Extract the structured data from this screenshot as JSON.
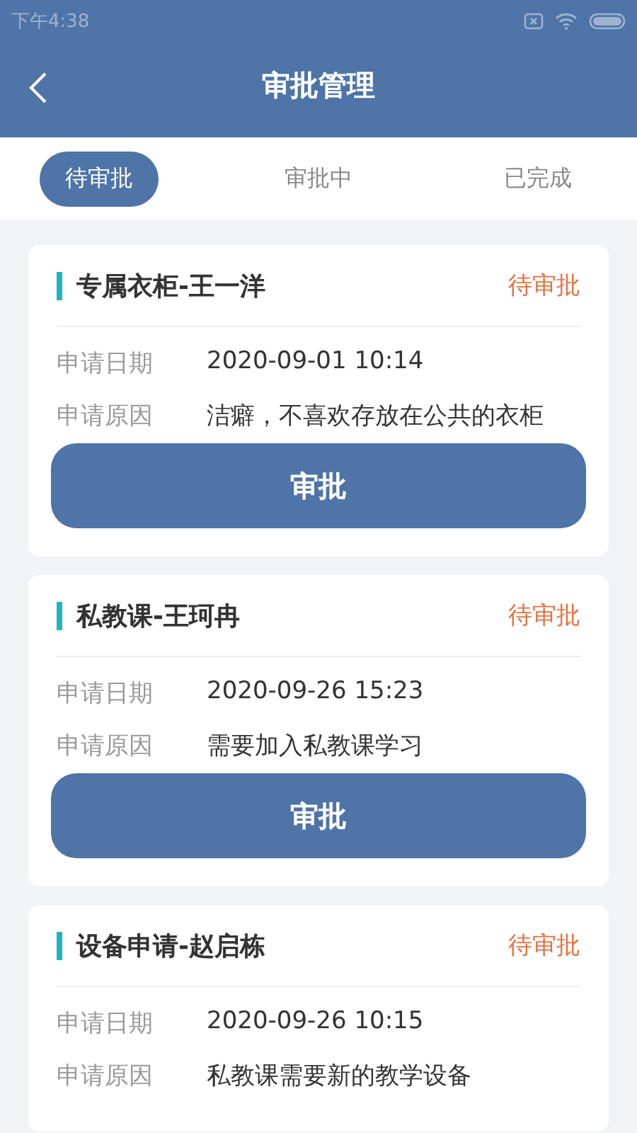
{
  "status_bar": {
    "time": "下午4:38"
  },
  "header": {
    "title": "审批管理"
  },
  "tabs": [
    {
      "label": "待审批",
      "selected": true
    },
    {
      "label": "审批中",
      "selected": false
    },
    {
      "label": "已完成",
      "selected": false
    }
  ],
  "cards": [
    {
      "title": "专属衣柜-王一洋",
      "status": "待审批",
      "fields": [
        {
          "label": "申请日期",
          "value": "2020-09-01 10:14"
        },
        {
          "label": "申请原因",
          "value": "洁癖，不喜欢存放在公共的衣柜"
        }
      ],
      "button": "审批"
    },
    {
      "title": "私教课-王珂冉",
      "status": "待审批",
      "fields": [
        {
          "label": "申请日期",
          "value": "2020-09-26 15:23"
        },
        {
          "label": "申请原因",
          "value": "需要加入私教课学习"
        }
      ],
      "button": "审批"
    },
    {
      "title": "设备申请-赵启栋",
      "status": "待审批",
      "fields": [
        {
          "label": "申请日期",
          "value": "2020-09-26 10:15"
        },
        {
          "label": "申请原因",
          "value": "私教课需要新的教学设备"
        }
      ]
    }
  ]
}
